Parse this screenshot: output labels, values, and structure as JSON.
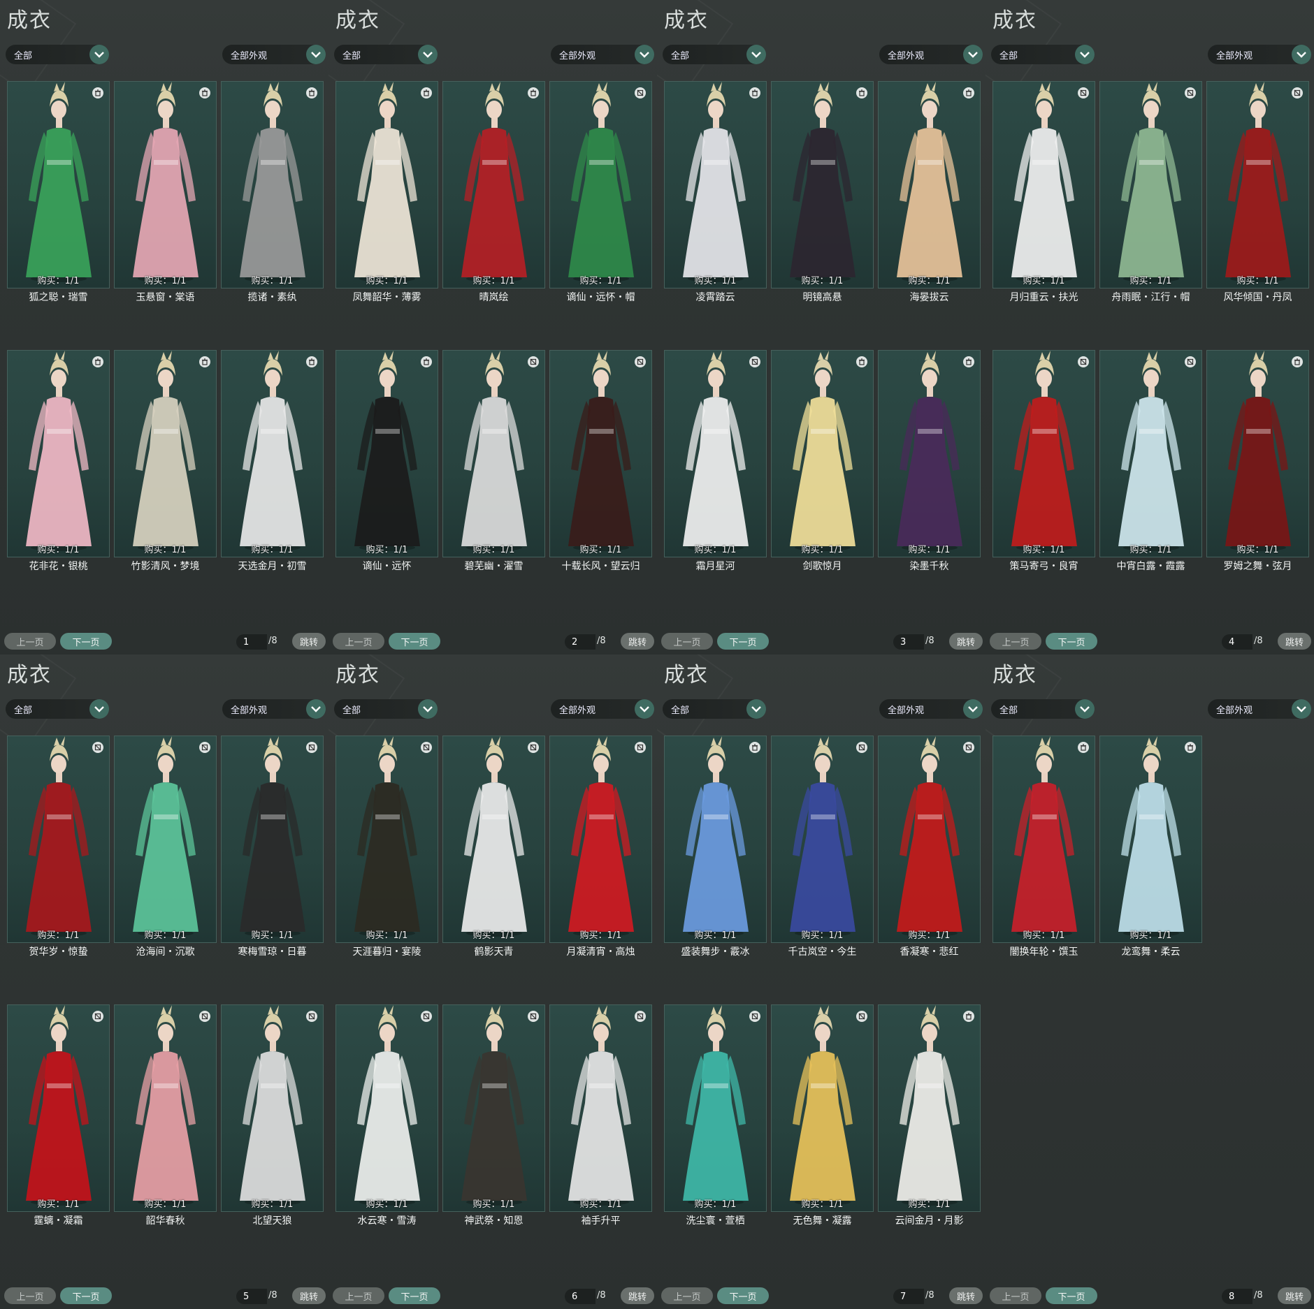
{
  "section_title": "成衣",
  "filter_left": "全部",
  "filter_right": "全部外观",
  "prev_label": "上一页",
  "next_label": "下一页",
  "jump_label": "跳转",
  "total_pages": "/8",
  "colors": {
    "accent": "#5a8c82",
    "card_bg": "#2a4642",
    "panel_bg": "#2f3433"
  },
  "panels": [
    {
      "page": "1",
      "items": [
        {
          "name": "狐之聪・瑞雪",
          "buy": "购买：1/1",
          "icon": "trash-icon",
          "tone": "#3aa35a"
        },
        {
          "name": "玉悬窗・棠语",
          "buy": "购买：1/1",
          "icon": "trash-icon",
          "tone": "#e6a7b4"
        },
        {
          "name": "揽诸・素纨",
          "buy": "购买：1/1",
          "icon": "trash-icon",
          "tone": "#9a9a9a"
        },
        {
          "name": "花非花・银桃",
          "buy": "购买：1/1",
          "icon": "trash-icon",
          "tone": "#f1b9c5"
        },
        {
          "name": "竹影清风・梦境",
          "buy": "购买：1/1",
          "icon": "trash-icon",
          "tone": "#d8d2c0"
        },
        {
          "name": "天选金月・初雪",
          "buy": "购买：1/1",
          "icon": "trash-icon",
          "tone": "#e8e8e8"
        }
      ]
    },
    {
      "page": "2",
      "items": [
        {
          "name": "凤舞韶华・薄雾",
          "buy": "购买：1/1",
          "icon": "trash-icon",
          "tone": "#efe6d8"
        },
        {
          "name": "晴岚绘",
          "buy": "购买：1/1",
          "icon": "trash-icon",
          "tone": "#b51f25"
        },
        {
          "name": "谪仙・远怀・帽",
          "buy": "购买：1/1",
          "icon": "no-trade-icon",
          "tone": "#2f8a4a"
        },
        {
          "name": "谪仙・远怀",
          "buy": "购买：1/1",
          "icon": "trash-icon",
          "tone": "#1b1b1b"
        },
        {
          "name": "碧芜幽・濯雪",
          "buy": "购买：1/1",
          "icon": "no-trade-icon",
          "tone": "#dcdcdc"
        },
        {
          "name": "十载长风・望云归",
          "buy": "购买：1/1",
          "icon": "no-trade-icon",
          "tone": "#3a1c1a"
        }
      ]
    },
    {
      "page": "3",
      "items": [
        {
          "name": "凌霄踏云",
          "buy": "购买：1/1",
          "icon": "trash-icon",
          "tone": "#e6e6ea"
        },
        {
          "name": "明镜高悬",
          "buy": "购买：1/1",
          "icon": "trash-icon",
          "tone": "#2c2630"
        },
        {
          "name": "海晏拔云",
          "buy": "购买：1/1",
          "icon": "trash-icon",
          "tone": "#e8c39a"
        },
        {
          "name": "霜月星河",
          "buy": "购买：1/1",
          "icon": "no-trade-icon",
          "tone": "#f0f0f0"
        },
        {
          "name": "剑歌惊月",
          "buy": "购买：1/1",
          "icon": "trash-icon",
          "tone": "#f2e09a"
        },
        {
          "name": "染墨千秋",
          "buy": "购买：1/1",
          "icon": "trash-icon",
          "tone": "#4a2a5a"
        }
      ]
    },
    {
      "page": "4",
      "items": [
        {
          "name": "月归重云・扶光",
          "buy": "购买：1/1",
          "icon": "no-trade-icon",
          "tone": "#f0f0f0"
        },
        {
          "name": "舟雨眠・江行・帽",
          "buy": "购买：1/1",
          "icon": "no-trade-icon",
          "tone": "#8fb893"
        },
        {
          "name": "风华倾国・丹凤",
          "buy": "购买：1/1",
          "icon": "no-trade-icon",
          "tone": "#9e1a1a"
        },
        {
          "name": "策马寄弓・良宵",
          "buy": "购买：1/1",
          "icon": "no-trade-icon",
          "tone": "#c01c1c"
        },
        {
          "name": "中宵白露・霞露",
          "buy": "购买：1/1",
          "icon": "no-trade-icon",
          "tone": "#cfe7ee"
        },
        {
          "name": "罗姆之舞・弦月",
          "buy": "购买：1/1",
          "icon": "trash-icon",
          "tone": "#7a1616"
        }
      ]
    },
    {
      "page": "5",
      "items": [
        {
          "name": "贺华岁・惊蛰",
          "buy": "购买：1/1",
          "icon": "no-trade-icon",
          "tone": "#a8181c"
        },
        {
          "name": "沧海间・沉歌",
          "buy": "购买：1/1",
          "icon": "no-trade-icon",
          "tone": "#5cc49a"
        },
        {
          "name": "寒梅雪琼・日暮",
          "buy": "购买：1/1",
          "icon": "no-trade-icon",
          "tone": "#2a2a2a"
        },
        {
          "name": "霆螭・凝霜",
          "buy": "购买：1/1",
          "icon": "no-trade-icon",
          "tone": "#c4121a"
        },
        {
          "name": "韶华春秋",
          "buy": "购买：1/1",
          "icon": "no-trade-icon",
          "tone": "#e8a0a6"
        },
        {
          "name": "北望天狼",
          "buy": "购买：1/1",
          "icon": "no-trade-icon",
          "tone": "#dedede"
        }
      ]
    },
    {
      "page": "6",
      "items": [
        {
          "name": "天涯暮归・宴陵",
          "buy": "购买：1/1",
          "icon": "no-trade-icon",
          "tone": "#2c2a22"
        },
        {
          "name": "鹤影天青",
          "buy": "购买：1/1",
          "icon": "no-trade-icon",
          "tone": "#ebebeb"
        },
        {
          "name": "月凝清宵・高烛",
          "buy": "购买：1/1",
          "icon": "no-trade-icon",
          "tone": "#d01a22"
        },
        {
          "name": "水云寒・雪涛",
          "buy": "购买：1/1",
          "icon": "no-trade-icon",
          "tone": "#eef0ee"
        },
        {
          "name": "神武祭・知恩",
          "buy": "购买：1/1",
          "icon": "no-trade-icon",
          "tone": "#3a3530"
        },
        {
          "name": "袖手升平",
          "buy": "购买：1/1",
          "icon": "no-trade-icon",
          "tone": "#e6e6e6"
        }
      ]
    },
    {
      "page": "7",
      "items": [
        {
          "name": "盛装舞步・霰冰",
          "buy": "购买：1/1",
          "icon": "trash-icon",
          "tone": "#6b9be0"
        },
        {
          "name": "千古岚空・今生",
          "buy": "购买：1/1",
          "icon": "no-trade-icon",
          "tone": "#3a4aa0"
        },
        {
          "name": "香凝寒・悲红",
          "buy": "购买：1/1",
          "icon": "no-trade-icon",
          "tone": "#c41a1a"
        },
        {
          "name": "洗尘寰・萱栖",
          "buy": "购买：1/1",
          "icon": "no-trade-icon",
          "tone": "#3fb8a8"
        },
        {
          "name": "无色舞・凝露",
          "buy": "购买：1/1",
          "icon": "no-trade-icon",
          "tone": "#e8c25a"
        },
        {
          "name": "云间金月・月影",
          "buy": "购买：1/1",
          "icon": "trash-icon",
          "tone": "#f0efea"
        }
      ]
    },
    {
      "page": "8",
      "items": [
        {
          "name": "闇换年轮・馔玉",
          "buy": "购买：1/1",
          "icon": "trash-icon",
          "tone": "#c8202a"
        },
        {
          "name": "龙鸾舞・柔云",
          "buy": "购买：1/1",
          "icon": "trash-icon",
          "tone": "#bfe0ea"
        }
      ]
    }
  ]
}
